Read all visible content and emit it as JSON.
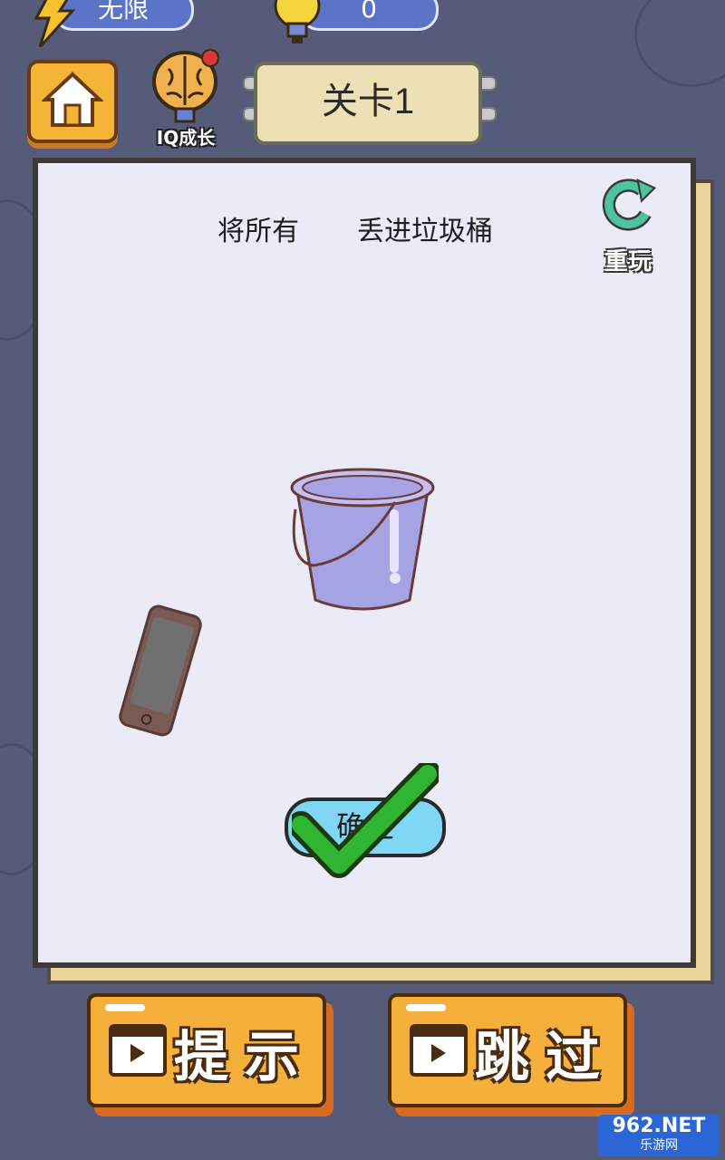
{
  "top_bar": {
    "energy_value": "无限",
    "hints_value": "0"
  },
  "iq_badge_label": "IQ成长",
  "level_title": "关卡1",
  "instruction": {
    "part1": "将所有",
    "part2": "丢进垃圾桶"
  },
  "replay_label": "重玩",
  "confirm_label": "确定",
  "bottom": {
    "hint_label": "提示",
    "skip_label": "跳过"
  },
  "watermark": {
    "brand": "962.NET",
    "sub": "乐游网"
  },
  "colors": {
    "background": "#565b7a",
    "board": "#ebebf8",
    "accent_orange": "#f5b03c",
    "bucket": "#a6a3e4",
    "check_green": "#2fb531"
  }
}
